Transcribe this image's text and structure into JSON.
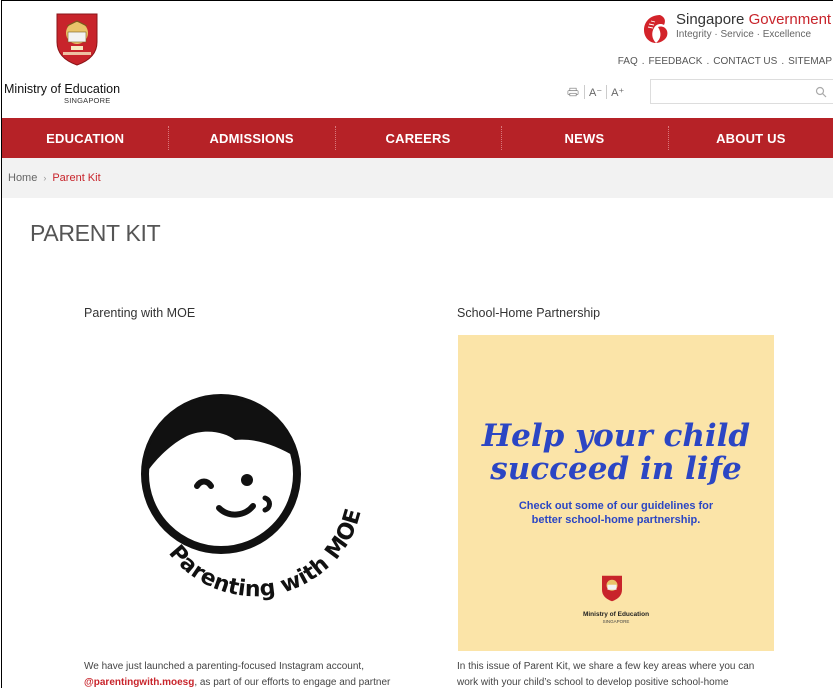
{
  "header": {
    "ministry_name": "Ministry of Education",
    "ministry_sub": "SINGAPORE",
    "gov_title_1": "Singapore ",
    "gov_title_2": "Government",
    "gov_tagline": "Integrity · Service · Excellence",
    "links": [
      "FAQ",
      "FEEDBACK",
      "CONTACT US",
      "SITEMAP"
    ],
    "link_separator": ".",
    "tools": {
      "print_icon": "printer-icon",
      "font_decrease": "A⁻",
      "font_increase": "A⁺"
    },
    "search": {
      "placeholder": "",
      "value": ""
    }
  },
  "nav": {
    "items": [
      "EDUCATION",
      "ADMISSIONS",
      "CAREERS",
      "NEWS",
      "ABOUT US"
    ],
    "background": "#b62227"
  },
  "breadcrumb": {
    "home": "Home",
    "separator": "›",
    "current": "Parent Kit"
  },
  "main": {
    "page_title": "PARENT KIT",
    "left": {
      "title": "Parenting with MOE",
      "image_text": "Parenting with MOE",
      "para_line1": "We have just launched a parenting-focused Instagram account,",
      "para_handle": "@parentingwith.moesg",
      "para_line2_rest": ", as part of our efforts to engage and partner"
    },
    "right": {
      "title": "School-Home Partnership",
      "promo_line1": "Help your child",
      "promo_line2": "succeed in life",
      "promo_sub1": "Check out some of our guidelines for",
      "promo_sub2": "better school-home partnership.",
      "promo_ministry": "Ministry of Education",
      "promo_ministry_sub": "SINGAPORE",
      "promo_background": "#fbe4a8",
      "promo_text_color": "#2b46c4",
      "para_line1": "In this issue of Parent Kit, we share a few key areas where you can",
      "para_line2": "work with your child’s school to develop positive school-home"
    }
  },
  "colors": {
    "accent": "#c8242b",
    "nav": "#b62227"
  }
}
